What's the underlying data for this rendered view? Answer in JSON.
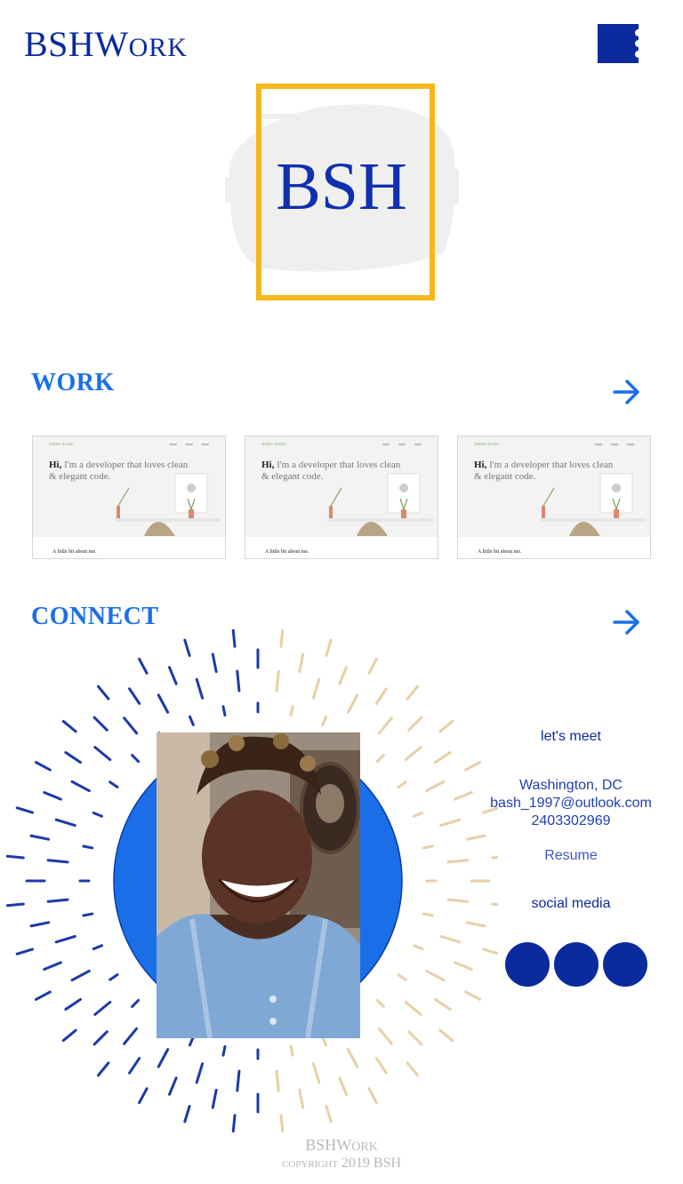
{
  "header": {
    "brand_main": "BSHW",
    "brand_rest": "ork",
    "menu_icon": "menu-icon",
    "brand_color": "#0a2a9e"
  },
  "logo": {
    "text": "BSH",
    "frame_color": "#f4b81c",
    "text_color": "#1030b0"
  },
  "work": {
    "title": "WORK",
    "arrow_icon": "arrow-right-icon",
    "projects": [
      {
        "nav_brand": "Adden Austin",
        "heading_bold": "Hi,",
        "heading_rest": " I'm a developer that loves clean & elegant code.",
        "subheading": "A little bit about me."
      },
      {
        "nav_brand": "Adden Austin",
        "heading_bold": "Hi,",
        "heading_rest": " I'm a developer that loves clean & elegant code.",
        "subheading": "A little bit about me."
      },
      {
        "nav_brand": "Adden Austin",
        "heading_bold": "Hi,",
        "heading_rest": " I'm a developer that loves clean & elegant code.",
        "subheading": "A little bit about me."
      }
    ]
  },
  "connect": {
    "title": "CONNECT",
    "arrow_icon": "arrow-right-icon",
    "meet_label": "let's meet",
    "location": "Washington, DC",
    "email": "bash_1997@outlook.com",
    "phone": "2403302969",
    "resume_label": "Resume",
    "social_label": "social media",
    "social_icons": [
      "social-icon-1",
      "social-icon-2",
      "social-icon-3"
    ],
    "accent": "#1a6fe8"
  },
  "footer": {
    "brand_main": "BSHW",
    "brand_rest": "ork",
    "copyright": "copyright 2019 BSH"
  }
}
